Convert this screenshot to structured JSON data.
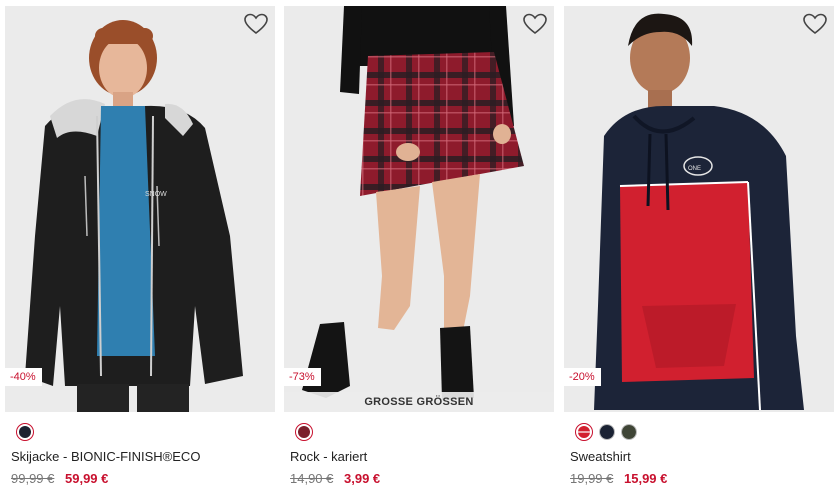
{
  "products": [
    {
      "name": "Skijacke - BIONIC-FINISH®ECO",
      "discount": "-40%",
      "old_price": "99,99 €",
      "new_price": "59,99 €",
      "ribbon": "",
      "image": "woman-black-ski-jacket",
      "wishlist_icon": "heart-outline-icon",
      "swatches": [
        {
          "color": "#1d2230",
          "active": true
        }
      ]
    },
    {
      "name": "Rock - kariert",
      "discount": "-73%",
      "old_price": "14,90 €",
      "new_price": "3,99 €",
      "ribbon": "GROSSE GRÖSSEN",
      "image": "red-plaid-skirt",
      "wishlist_icon": "heart-outline-icon",
      "swatches": [
        {
          "color": "#7a1f2b",
          "active": true
        }
      ]
    },
    {
      "name": "Sweatshirt",
      "discount": "-20%",
      "old_price": "19,99 €",
      "new_price": "15,99 €",
      "ribbon": "",
      "image": "man-red-navy-hoodie",
      "wishlist_icon": "heart-outline-icon",
      "swatches": [
        {
          "color": "#d2202f",
          "active": true
        },
        {
          "color": "#1b2233",
          "active": false
        },
        {
          "color": "#3f4536",
          "active": false
        }
      ]
    }
  ],
  "colors": {
    "sale_red": "#c8102e",
    "image_bg": "#efefef",
    "text": "#222222",
    "strike": "#777777"
  }
}
